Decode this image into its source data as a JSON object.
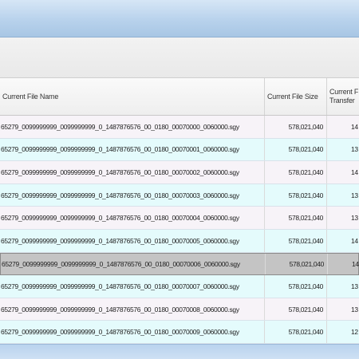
{
  "grid": {
    "columns": {
      "name": "Current File Name",
      "size": "Current File Size",
      "transferred_line1": "Current F",
      "transferred_line2": "Transfer"
    },
    "rows": [
      {
        "name": "65279_0099999999_0099999999_0_1487876576_00_0180_00070000_0060000.sgy",
        "size": "578,021,040",
        "transferred": "14",
        "style": "alt0"
      },
      {
        "name": "65279_0099999999_0099999999_0_1487876576_00_0180_00070001_0060000.sgy",
        "size": "578,021,040",
        "transferred": "13",
        "style": "alt1"
      },
      {
        "name": "65279_0099999999_0099999999_0_1487876576_00_0180_00070002_0060000.sgy",
        "size": "578,021,040",
        "transferred": "14",
        "style": "alt0"
      },
      {
        "name": "65279_0099999999_0099999999_0_1487876576_00_0180_00070003_0060000.sgy",
        "size": "578,021,040",
        "transferred": "13",
        "style": "alt1"
      },
      {
        "name": "65279_0099999999_0099999999_0_1487876576_00_0180_00070004_0060000.sgy",
        "size": "578,021,040",
        "transferred": "13",
        "style": "alt0"
      },
      {
        "name": "65279_0099999999_0099999999_0_1487876576_00_0180_00070005_0060000.sgy",
        "size": "578,021,040",
        "transferred": "14",
        "style": "alt1"
      },
      {
        "name": "65279_0099999999_0099999999_0_1487876576_00_0180_00070006_0060000.sgy",
        "size": "578,021,040",
        "transferred": "14",
        "style": "selected"
      },
      {
        "name": "65279_0099999999_0099999999_0_1487876576_00_0180_00070007_0060000.sgy",
        "size": "578,021,040",
        "transferred": "13",
        "style": "alt1"
      },
      {
        "name": "65279_0099999999_0099999999_0_1487876576_00_0180_00070008_0060000.sgy",
        "size": "578,021,040",
        "transferred": "13",
        "style": "alt0"
      },
      {
        "name": "65279_0099999999_0099999999_0_1487876576_00_0180_00070009_0060000.sgy",
        "size": "578,021,040",
        "transferred": "12",
        "style": "alt1"
      }
    ]
  },
  "colors": {
    "titlebar": "#b8d2ec",
    "row_alt_a": "#f7f3f8",
    "row_alt_b": "#e4fbfc",
    "row_selected": "#c4c4c4"
  }
}
